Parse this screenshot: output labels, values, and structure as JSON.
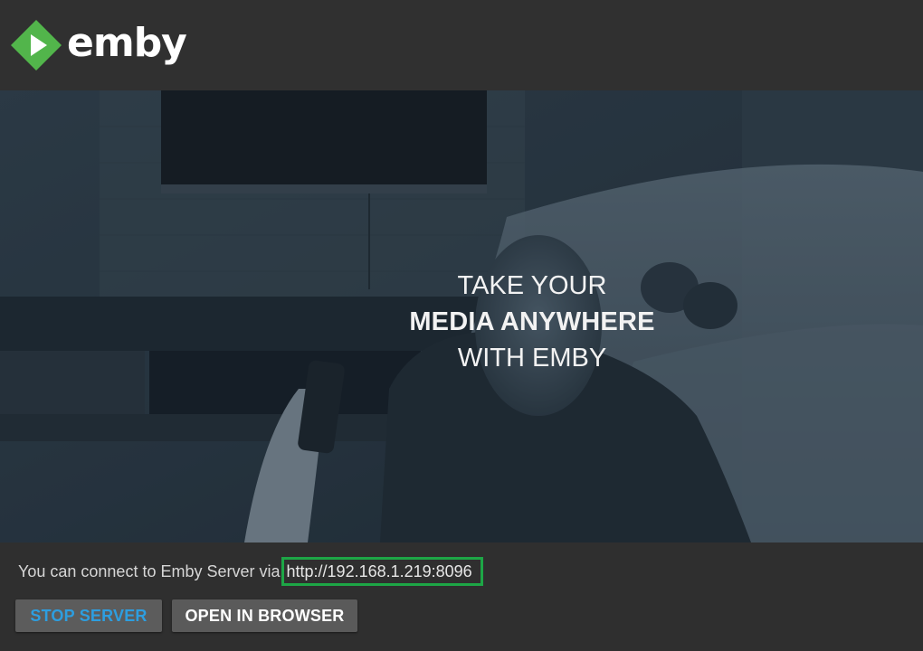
{
  "header": {
    "logo_text": "emby",
    "logo_icon": "emby-play-diamond-icon",
    "brand_color": "#52b54b"
  },
  "hero": {
    "line1": "TAKE YOUR",
    "line2": "MEDIA ANYWHERE",
    "line3": "WITH EMBY"
  },
  "footer": {
    "connect_prefix": "You can connect to Emby Server via",
    "server_url": "http://192.168.1.219:8096",
    "highlight_color": "#1da646",
    "stop_button": "STOP SERVER",
    "open_button": "OPEN IN BROWSER"
  }
}
